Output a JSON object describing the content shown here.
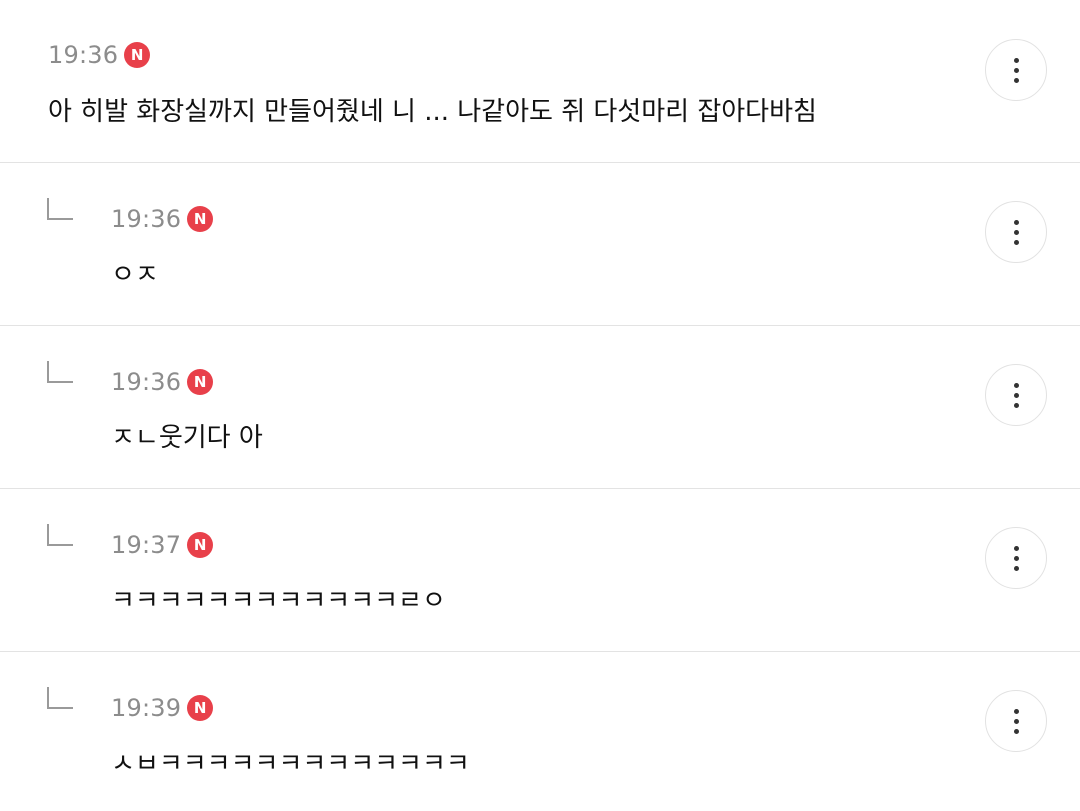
{
  "comments": [
    {
      "time": "19:36",
      "badge": "N",
      "text": "아 히발 화장실까지 만들어줬네 니 ... 나같아도 쥐 다섯마리 잡아다바침",
      "is_reply": false,
      "more_icon": "more-vertical-icon"
    },
    {
      "time": "19:36",
      "badge": "N",
      "text": "ㅇㅈ",
      "is_reply": true,
      "more_icon": "more-vertical-icon"
    },
    {
      "time": "19:36",
      "badge": "N",
      "text": "ㅈㄴ웃기다 아",
      "is_reply": true,
      "more_icon": "more-vertical-icon"
    },
    {
      "time": "19:37",
      "badge": "N",
      "text": "ㅋㅋㅋㅋㅋㅋㅋㅋㅋㅋㅋㅋㄹㅇ",
      "is_reply": true,
      "more_icon": "more-vertical-icon"
    },
    {
      "time": "19:39",
      "badge": "N",
      "text": "ㅅㅂㅋㅋㅋㅋㅋㅋㅋㅋㅋㅋㅋㅋㅋ",
      "is_reply": true,
      "more_icon": "more-vertical-icon"
    }
  ],
  "colors": {
    "badge": "#e8404a",
    "time": "#8c8c8c",
    "divider": "#e3e3e3",
    "text": "#111111"
  }
}
